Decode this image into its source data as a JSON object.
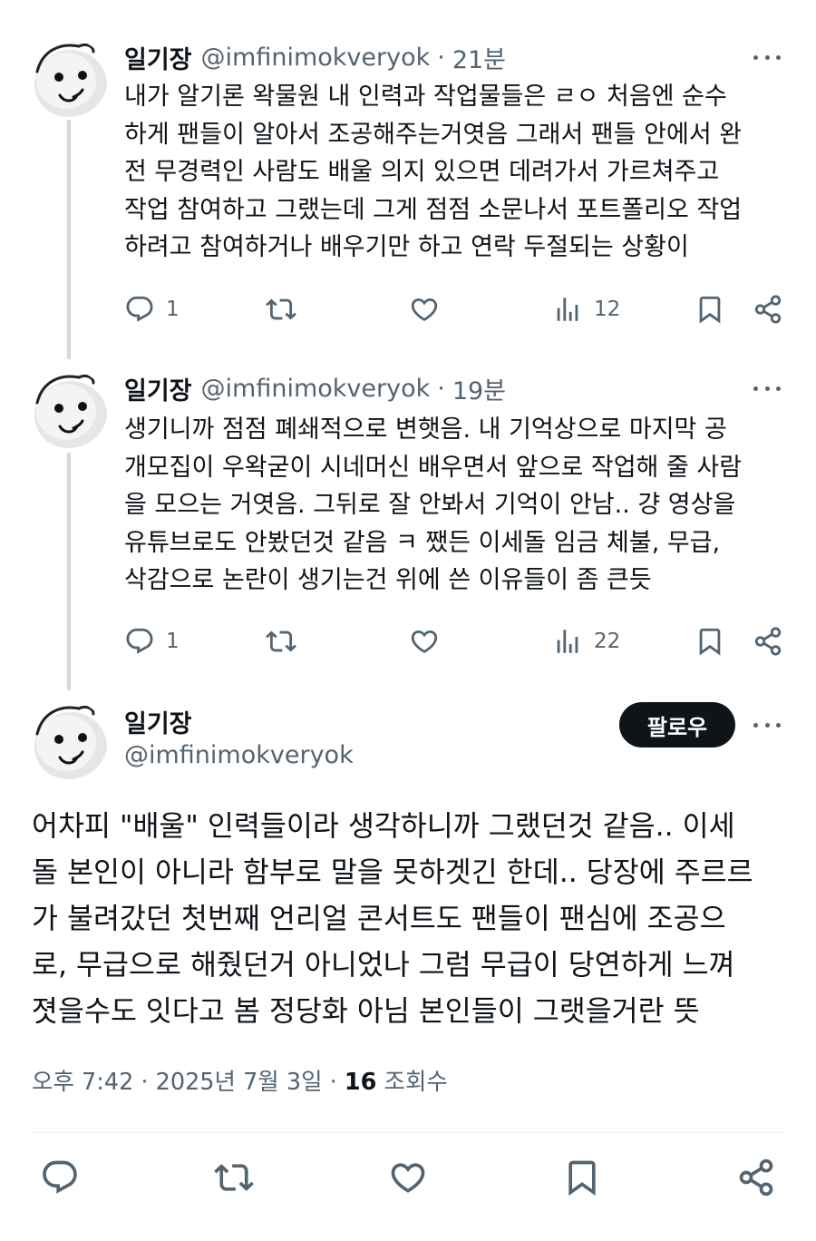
{
  "thread": [
    {
      "name": "일기장",
      "handle": "@imfinimokveryok",
      "time": "21분",
      "text": "내가 알기론 왁물원 내 인력과 작업물들은 ㄹㅇ 처음엔 순수\n하게 팬들이 알아서 조공해주는거엿음 그래서 팬들 안에서 완\n전 무경력인 사람도 배울 의지 있으면 데려가서 가르쳐주고\n작업 참여하고 그랬는데 그게 점점 소문나서 포트폴리오 작업\n하려고 참여하거나 배우기만 하고 연락 두절되는 상황이",
      "replies": "1",
      "views": "12"
    },
    {
      "name": "일기장",
      "handle": "@imfinimokveryok",
      "time": "19분",
      "text": "생기니까 점점 폐쇄적으로 변햇음. 내 기억상으로 마지막 공\n개모집이 우왁굳이 시네머신 배우면서 앞으로 작업해 줄 사람\n을 모으는 거엿음. 그뒤로 잘 안봐서 기억이 안남.. 걍 영상을\n유튜브로도 안봤던것 같음 ㅋ 쨌든 이세돌 임금 체불, 무급,\n삭감으로 논란이 생기는건 위에 쓴 이유들이 좀 큰듯",
      "replies": "1",
      "views": "22"
    }
  ],
  "main": {
    "name": "일기장",
    "handle": "@imfinimokveryok",
    "follow_label": "팔로우",
    "text": "어차피 \"배울\" 인력들이라 생각하니까 그랬던것 같음.. 이세\n돌 본인이 아니라 함부로 말을 못하겟긴 한데.. 당장에 주르르\n가 불려갔던 첫번째 언리얼 콘서트도 팬들이 팬심에 조공으\n로, 무급으로 해줬던거 아니었나 그럼 무급이 당연하게 느껴\n졋을수도 잇다고 봄 정당화 아님 본인들이 그랫을거란 뜻",
    "time": "오후 7:42",
    "date": "2025년 7월 3일",
    "separator": "·",
    "views": "16",
    "views_label": "조회수"
  },
  "icons": {
    "reply": "reply-icon",
    "retweet": "retweet-icon",
    "like": "heart-icon",
    "views": "analytics-icon",
    "bookmark": "bookmark-icon",
    "share": "share-icon",
    "more": "more-icon"
  },
  "colors": {
    "text": "#0f1419",
    "secondary": "#536471",
    "thread_line": "#cfd9de",
    "button_bg": "#0f1419"
  }
}
